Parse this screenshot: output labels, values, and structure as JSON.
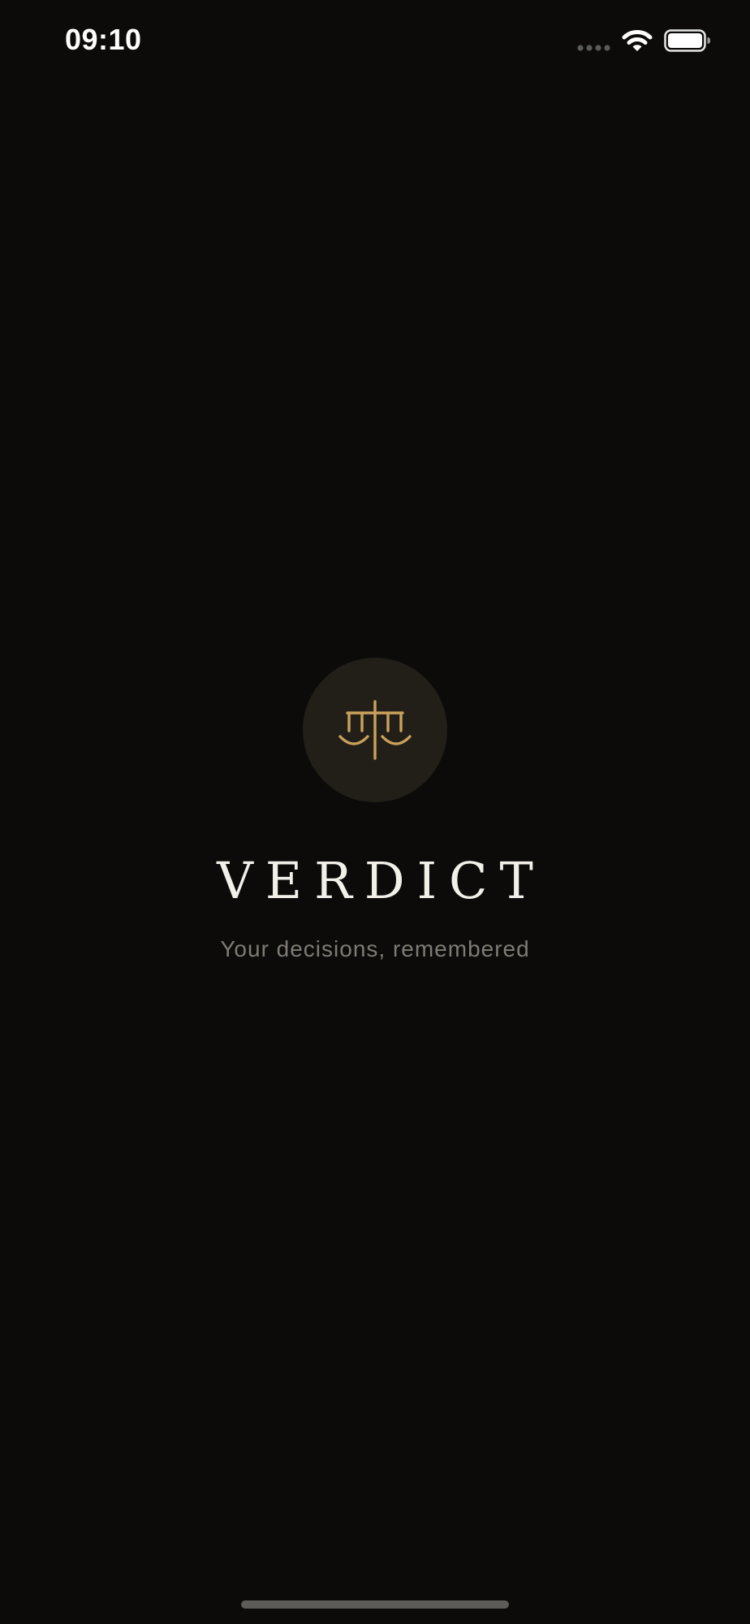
{
  "status_bar": {
    "time": "09:10",
    "signal_icon": "cellular-signal-icon",
    "wifi_icon": "wifi-icon",
    "battery_icon": "battery-icon"
  },
  "splash": {
    "logo_icon": "scales-of-justice-icon",
    "title": "VERDICT",
    "tagline": "Your decisions, remembered"
  },
  "colors": {
    "background": "#0c0b0a",
    "logo_circle": "#221f19",
    "accent_gold": "#c9a15c",
    "title": "#f3f0ea",
    "tagline": "#7f7b74"
  }
}
